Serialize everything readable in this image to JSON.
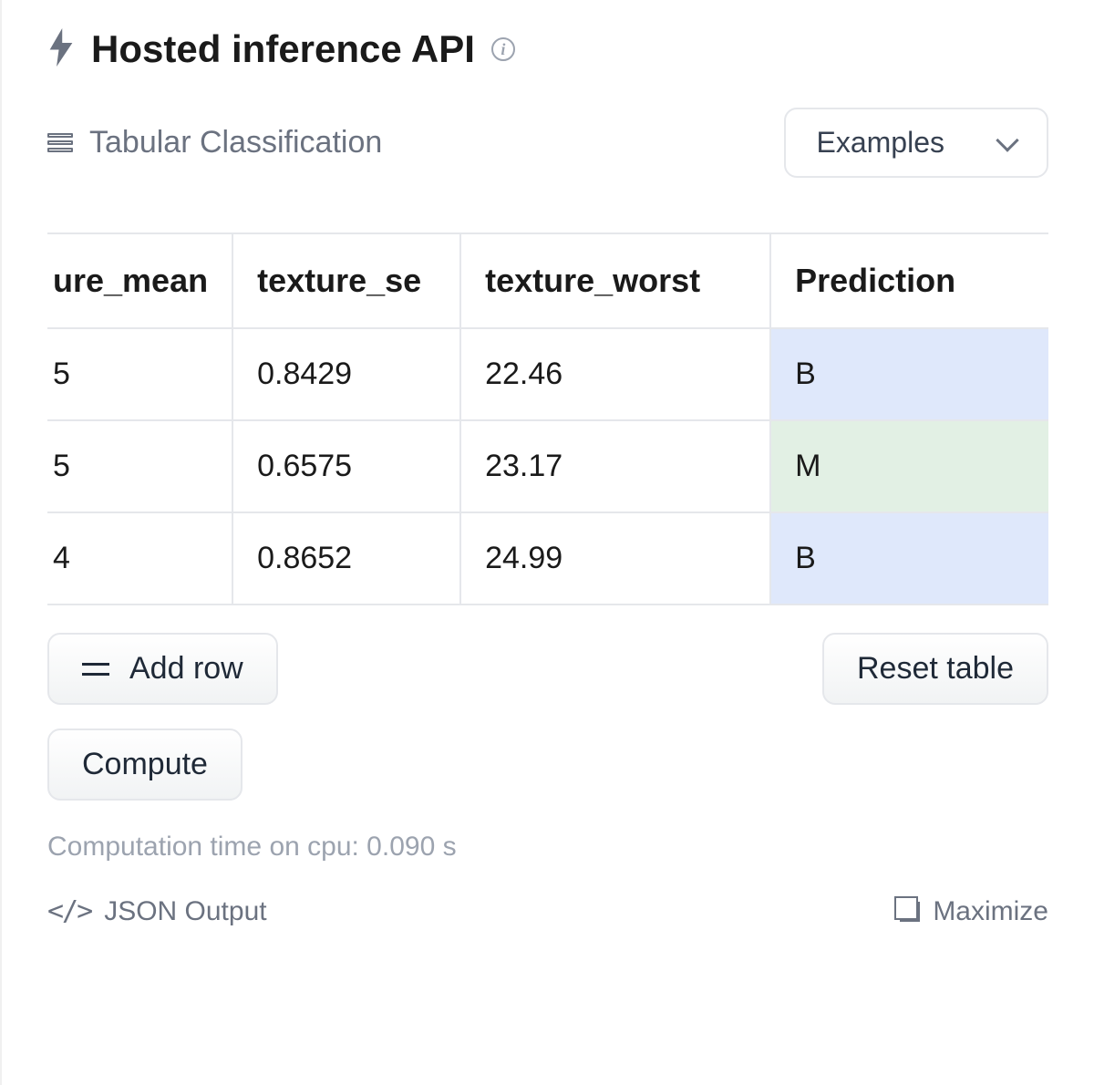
{
  "header": {
    "title": "Hosted inference API"
  },
  "subhead": {
    "task_label": "Tabular Classification",
    "examples_label": "Examples"
  },
  "table": {
    "columns": [
      "ure_mean",
      "texture_se",
      "texture_worst",
      "Prediction"
    ],
    "rows": [
      {
        "ure_mean": "5",
        "texture_se": "0.8429",
        "texture_worst": "22.46",
        "prediction": "B"
      },
      {
        "ure_mean": "5",
        "texture_se": "0.6575",
        "texture_worst": "23.17",
        "prediction": "M"
      },
      {
        "ure_mean": "4",
        "texture_se": "0.8652",
        "texture_worst": "24.99",
        "prediction": "B"
      }
    ]
  },
  "buttons": {
    "add_row": "Add row",
    "reset_table": "Reset table",
    "compute": "Compute"
  },
  "perf_text": "Computation time on cpu: 0.090 s",
  "footer": {
    "json_output": "JSON Output",
    "maximize": "Maximize"
  }
}
